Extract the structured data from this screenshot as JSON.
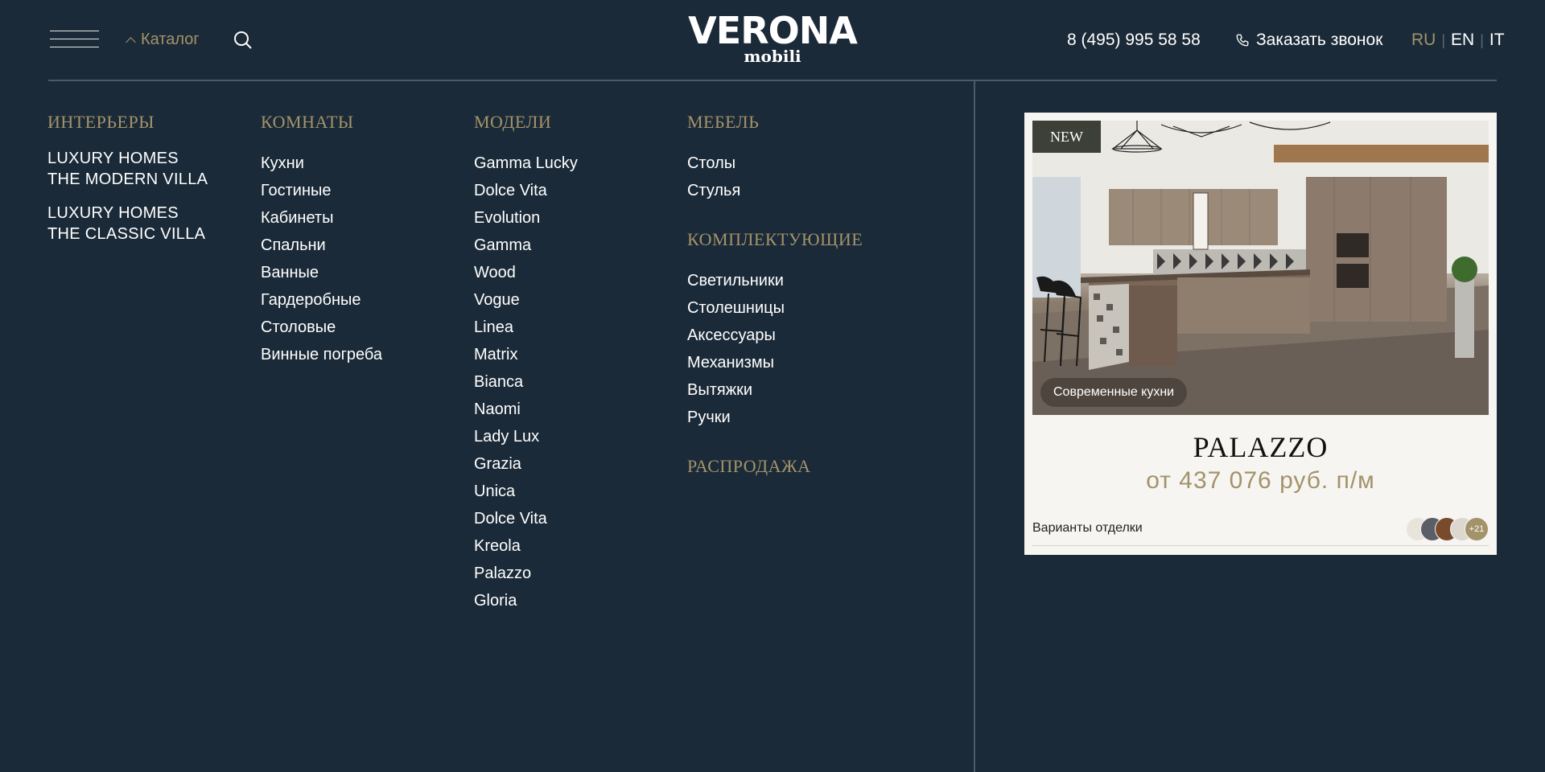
{
  "header": {
    "catalog_label": "Каталог",
    "logo_main": "VERONA",
    "logo_sub": "mobili",
    "phone": "8 (495) 995 58 58",
    "callback_label": "Заказать звонок",
    "langs": [
      "RU",
      "EN",
      "IT"
    ],
    "active_lang": "RU",
    "icons": {
      "menu": "hamburger-icon",
      "catalog": "chevron-up-icon",
      "search": "search-icon",
      "callback": "phone-icon"
    }
  },
  "menu": {
    "interiors": {
      "title": "ИНТЕРЬЕРЫ",
      "items": [
        {
          "line1": "LUXURY HOMES",
          "line2": "THE MODERN VILLA"
        },
        {
          "line1": "LUXURY HOMES",
          "line2": "THE CLASSIC VILLA"
        }
      ]
    },
    "rooms": {
      "title": "КОМНАТЫ",
      "items": [
        "Кухни",
        "Гостиные",
        "Кабинеты",
        "Спальни",
        "Ванные",
        "Гардеробные",
        "Столовые",
        "Винные погреба"
      ]
    },
    "models": {
      "title": "МОДЕЛИ",
      "items": [
        "Gamma Lucky",
        "Dolce Vita",
        "Evolution",
        "Gamma",
        "Wood",
        "Vogue",
        "Linea",
        "Matrix",
        "Bianca",
        "Naomi",
        "Lady Lux",
        "Grazia",
        "Unica",
        "Dolce Vita",
        "Kreola",
        "Palazzo",
        "Gloria"
      ]
    },
    "furniture": {
      "title": "МЕБЕЛЬ",
      "items": [
        "Столы",
        "Стулья"
      ]
    },
    "components": {
      "title": "КОМПЛЕКТУЮЩИЕ",
      "items": [
        "Светильники",
        "Столешницы",
        "Аксессуары",
        "Механизмы",
        "Вытяжки",
        "Ручки"
      ]
    },
    "sale": {
      "title": "РАСПРОДАЖА"
    }
  },
  "card": {
    "badge": "NEW",
    "tag": "Современные кухни",
    "title": "PALAZZO",
    "price": "от 437 076 руб. п/м",
    "finish_label": "Варианты отделки",
    "swatches_more": "+21",
    "swatch_colors": [
      "#e8e4dc",
      "#5b5e66",
      "#7a4a2c",
      "#dcd8d0",
      "#a3936a"
    ]
  },
  "colors": {
    "background": "#1b2a38",
    "accent": "#a3936a",
    "divider": "#4d5b67"
  }
}
